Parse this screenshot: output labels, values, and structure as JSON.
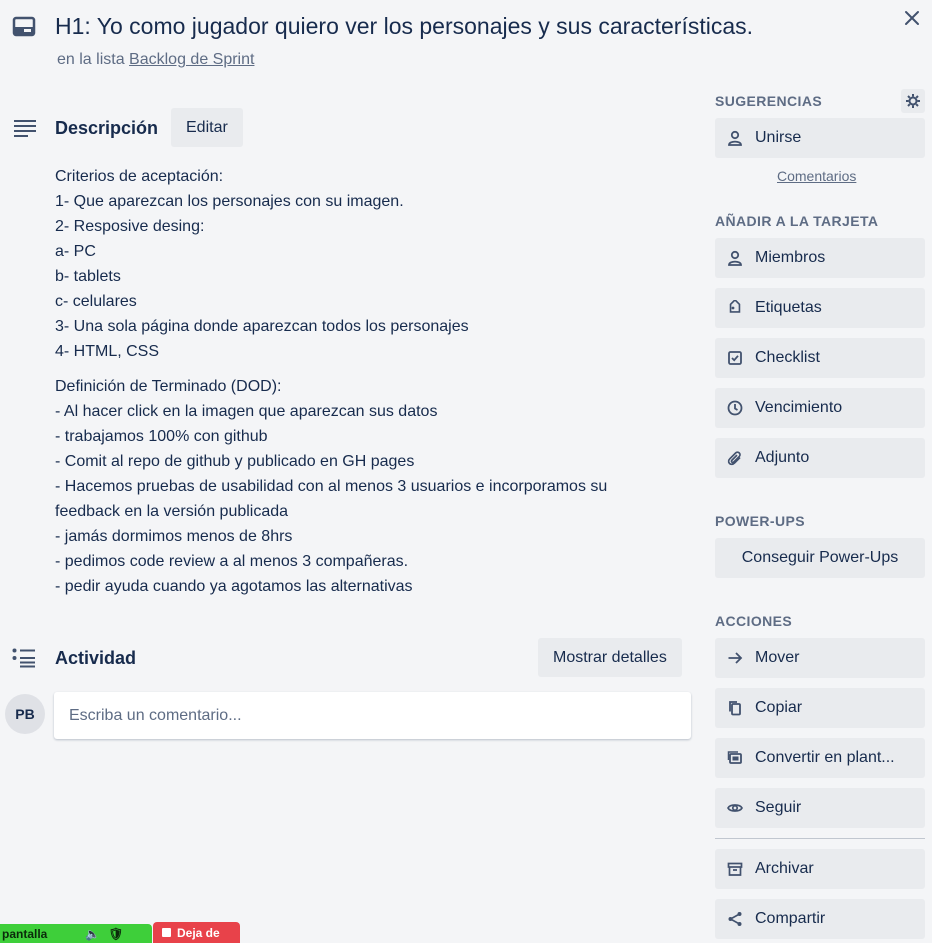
{
  "card": {
    "title": "H1: Yo como jugador quiero ver los personajes y sus características.",
    "list_prefix": "en la lista",
    "list_name": "Backlog de Sprint"
  },
  "description": {
    "heading": "Descripción",
    "edit_label": "Editar",
    "paragraphs": [
      [
        "Criterios de aceptación:",
        "1- Que aparezcan los personajes con su imagen.",
        "2- Resposive desing:",
        "a- PC",
        "b- tablets",
        "c- celulares",
        "3- Una sola página donde aparezcan todos los personajes",
        "4- HTML, CSS"
      ],
      [
        "Definición de Terminado (DOD):",
        "- Al hacer click en la imagen que aparezcan sus datos",
        "- trabajamos 100% con github",
        "- Comit al repo de github y publicado en GH pages",
        "- Hacemos pruebas de usabilidad con al menos 3 usuarios e incorporamos su feedback en la versión publicada",
        "- jamás dormimos menos de 8hrs",
        "- pedimos code review a al menos 3 compañeras.",
        "- pedir ayuda cuando ya agotamos las alternativas"
      ]
    ]
  },
  "activity": {
    "heading": "Actividad",
    "details_label": "Mostrar detalles",
    "avatar_initials": "PB",
    "comment_placeholder": "Escriba un comentario..."
  },
  "sidebar": {
    "suggestions_heading": "SUGERENCIAS",
    "join_label": "Unirse",
    "comments_link": "Comentarios",
    "add_heading": "AÑADIR A LA TARJETA",
    "add_items": [
      {
        "label": "Miembros",
        "icon": "person-icon"
      },
      {
        "label": "Etiquetas",
        "icon": "tag-icon"
      },
      {
        "label": "Checklist",
        "icon": "checkbox-icon"
      },
      {
        "label": "Vencimiento",
        "icon": "clock-icon"
      },
      {
        "label": "Adjunto",
        "icon": "paperclip-icon"
      }
    ],
    "powerups_heading": "POWER-UPS",
    "powerups_label": "Conseguir Power-Ups",
    "actions_heading": "ACCIONES",
    "actions": [
      {
        "label": "Mover",
        "icon": "arrow-right-icon"
      },
      {
        "label": "Copiar",
        "icon": "copy-icon"
      },
      {
        "label": "Convertir en plant...",
        "icon": "template-icon"
      },
      {
        "label": "Seguir",
        "icon": "eye-icon"
      }
    ],
    "more_actions": [
      {
        "label": "Archivar",
        "icon": "archive-icon"
      },
      {
        "label": "Compartir",
        "icon": "share-icon"
      }
    ]
  },
  "screen_share": {
    "status_text": "pantalla",
    "stop_label": "Deja de"
  }
}
